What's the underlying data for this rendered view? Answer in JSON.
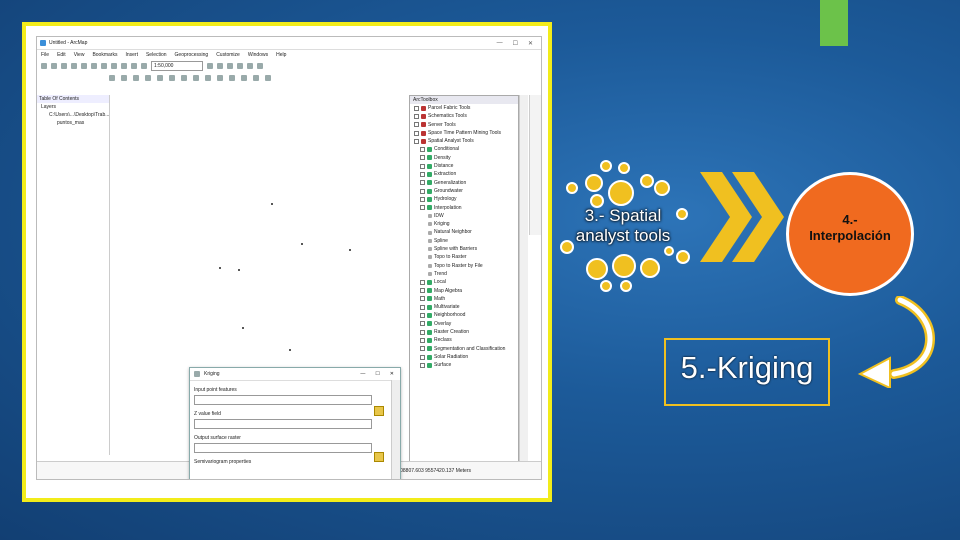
{
  "app": {
    "title": "Untitled - ArcMap",
    "window_buttons": [
      "—",
      "☐",
      "✕"
    ],
    "menu": [
      "File",
      "Edit",
      "View",
      "Bookmarks",
      "Insert",
      "Selection",
      "Geoprocessing",
      "Customize",
      "Windows",
      "Help"
    ],
    "scale": "1:50,000"
  },
  "toc": {
    "title": "Table Of Contents",
    "rows": [
      "Layers",
      "C:\\Users\\...\\Desktop\\Trab...",
      "puntos_mas"
    ]
  },
  "toolbox": {
    "title": "ArcToolbox",
    "items": [
      {
        "label": "Parcel Fabric Tools",
        "kind": "box"
      },
      {
        "label": "Schematics Tools",
        "kind": "box"
      },
      {
        "label": "Server Tools",
        "kind": "box"
      },
      {
        "label": "Space Time Pattern Mining Tools",
        "kind": "box"
      },
      {
        "label": "Spatial Analyst Tools",
        "kind": "box"
      },
      {
        "label": "Conditional",
        "kind": "sub"
      },
      {
        "label": "Density",
        "kind": "sub"
      },
      {
        "label": "Distance",
        "kind": "sub"
      },
      {
        "label": "Extraction",
        "kind": "sub"
      },
      {
        "label": "Generalization",
        "kind": "sub"
      },
      {
        "label": "Groundwater",
        "kind": "sub"
      },
      {
        "label": "Hydrology",
        "kind": "sub"
      },
      {
        "label": "Interpolation",
        "kind": "sub"
      },
      {
        "label": "IDW",
        "kind": "tool"
      },
      {
        "label": "Kriging",
        "kind": "tool"
      },
      {
        "label": "Natural Neighbor",
        "kind": "tool"
      },
      {
        "label": "Spline",
        "kind": "tool"
      },
      {
        "label": "Spline with Barriers",
        "kind": "tool"
      },
      {
        "label": "Topo to Raster",
        "kind": "tool"
      },
      {
        "label": "Topo to Raster by File",
        "kind": "tool"
      },
      {
        "label": "Trend",
        "kind": "tool"
      },
      {
        "label": "Local",
        "kind": "sub"
      },
      {
        "label": "Map Algebra",
        "kind": "sub"
      },
      {
        "label": "Math",
        "kind": "sub"
      },
      {
        "label": "Multivariate",
        "kind": "sub"
      },
      {
        "label": "Neighborhood",
        "kind": "sub"
      },
      {
        "label": "Overlay",
        "kind": "sub"
      },
      {
        "label": "Raster Creation",
        "kind": "sub"
      },
      {
        "label": "Reclass",
        "kind": "sub"
      },
      {
        "label": "Segmentation and Classification",
        "kind": "sub"
      },
      {
        "label": "Solar Radiation",
        "kind": "sub"
      },
      {
        "label": "Surface",
        "kind": "sub"
      }
    ]
  },
  "kriging_dialog": {
    "title": "Kriging",
    "window_buttons": [
      "—",
      "☐",
      "✕"
    ],
    "fields": [
      {
        "label": "Input point features"
      },
      {
        "label": "Z value field"
      },
      {
        "label": "Output surface raster"
      }
    ],
    "footer": "Semivariogram properties"
  },
  "status": {
    "coords": "708807.603  9557420.137 Meters"
  },
  "slide": {
    "step3": "3.- Spatial analyst tools",
    "step4_line1": "4.-",
    "step4_line2": "Interpolación",
    "step5": "5.-Kriging",
    "colors": {
      "frame": "#f2ec1a",
      "gold": "#f0c020",
      "orange": "#f06a1f",
      "accent": "#6cc24a"
    }
  }
}
